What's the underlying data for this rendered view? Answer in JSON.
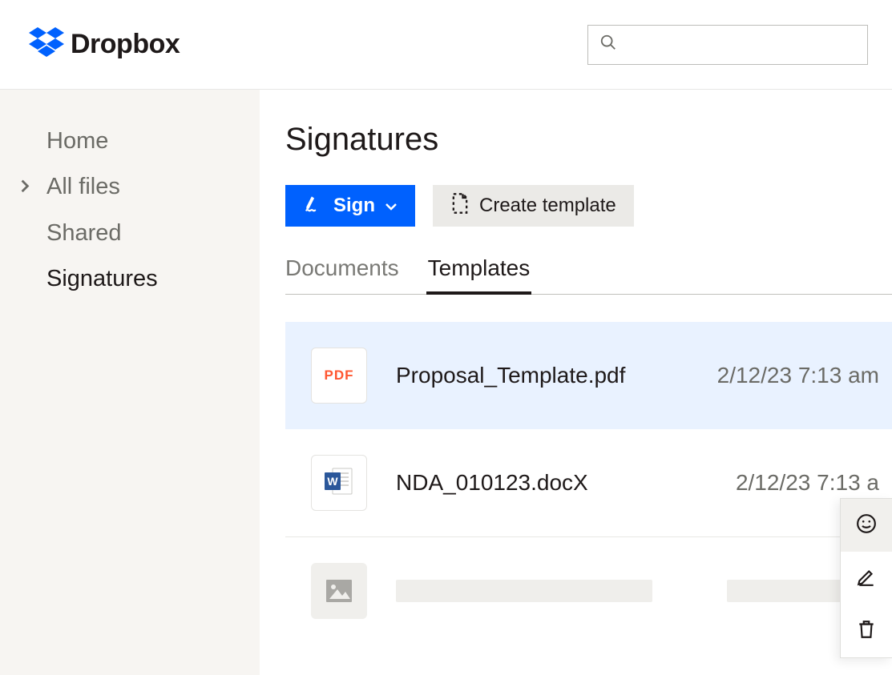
{
  "brand": "Dropbox",
  "search": {
    "placeholder": ""
  },
  "sidebar": {
    "items": [
      {
        "label": "Home",
        "active": false,
        "expandable": false
      },
      {
        "label": "All files",
        "active": false,
        "expandable": true
      },
      {
        "label": "Shared",
        "active": false,
        "expandable": false
      },
      {
        "label": "Signatures",
        "active": true,
        "expandable": false
      }
    ]
  },
  "page": {
    "title": "Signatures",
    "actions": {
      "sign_label": "Sign",
      "create_template_label": "Create template"
    },
    "tabs": {
      "documents_label": "Documents",
      "templates_label": "Templates",
      "active": "templates"
    }
  },
  "files": [
    {
      "name": "Proposal_Template.pdf",
      "date": "2/12/23 7:13 am",
      "type": "pdf",
      "pdf_badge": "PDF",
      "highlighted": true
    },
    {
      "name": "NDA_010123.docX",
      "date": "2/12/23 7:13 a",
      "type": "docx",
      "highlighted": false
    }
  ],
  "icons": {
    "smiley": "smiley-icon",
    "edit": "edit-icon",
    "delete": "delete-icon"
  }
}
